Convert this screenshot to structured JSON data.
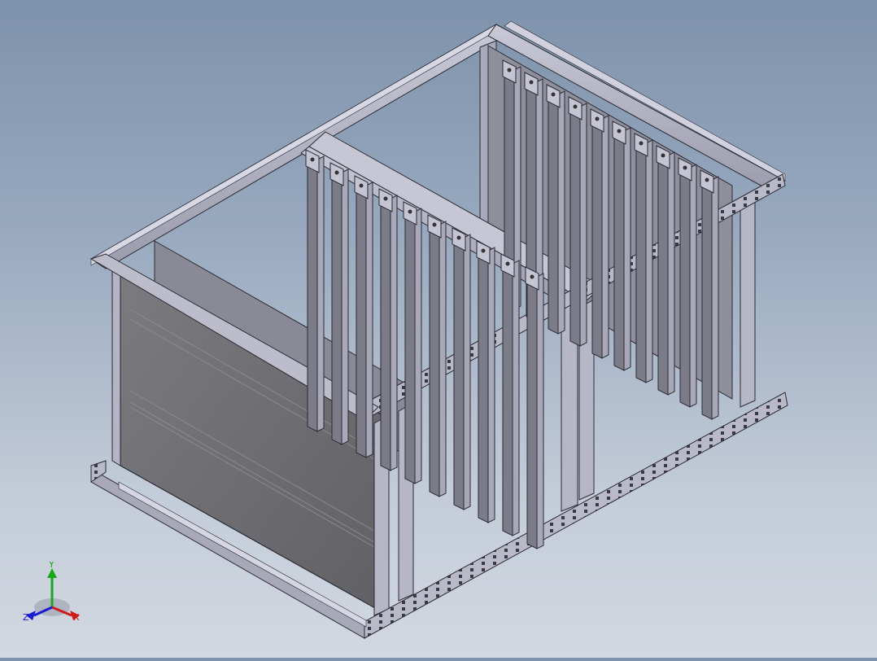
{
  "scene": {
    "description_tag": "isometric-cad-rack-assembly",
    "background_top": "#7d92ab",
    "background_bottom": "#d2d8e1"
  },
  "triad": {
    "x_label": "X",
    "y_label": "Y",
    "z_label": "Z",
    "x_color": "#d11a1a",
    "y_color": "#1aa51a",
    "z_color": "#1a1ad1"
  }
}
